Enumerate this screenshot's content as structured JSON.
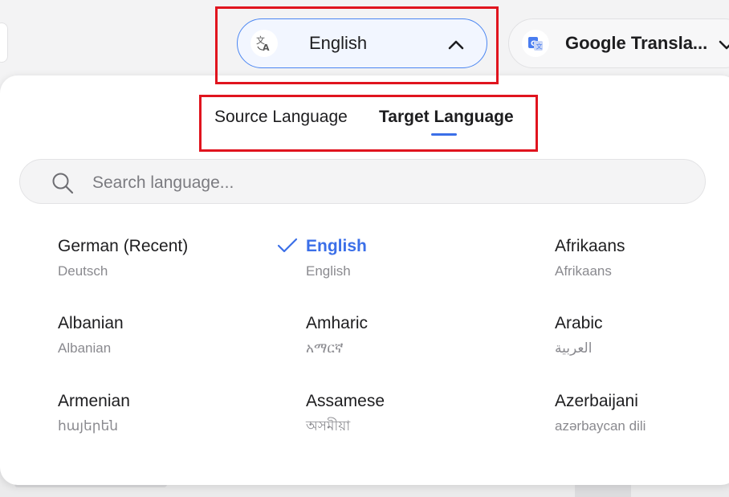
{
  "top_bar": {
    "language_selector": {
      "label": "English",
      "icon": "translate-icon",
      "accent_color": "#4b86f2"
    },
    "service_selector": {
      "label": "Google Transla...",
      "icon": "google-translate-icon"
    }
  },
  "panel": {
    "tabs": [
      {
        "label": "Source Language",
        "active": false
      },
      {
        "label": "Target Language",
        "active": true
      }
    ],
    "search": {
      "placeholder": "Search language...",
      "value": ""
    },
    "languages": [
      {
        "name": "German (Recent)",
        "native": "Deutsch",
        "selected": false
      },
      {
        "name": "English",
        "native": "English",
        "selected": true
      },
      {
        "name": "Afrikaans",
        "native": "Afrikaans",
        "selected": false
      },
      {
        "name": "Albanian",
        "native": "Albanian",
        "selected": false
      },
      {
        "name": "Amharic",
        "native": "አማርኛ",
        "selected": false
      },
      {
        "name": "Arabic",
        "native": "العربية",
        "selected": false
      },
      {
        "name": "Armenian",
        "native": "հայերեն",
        "selected": false
      },
      {
        "name": "Assamese",
        "native": "অসমীয়া",
        "selected": false
      },
      {
        "name": "Azerbaijani",
        "native": "azərbaycan dili",
        "selected": false
      }
    ],
    "selected_color": "#3b6fe8"
  },
  "highlight_color": "#e0141e"
}
